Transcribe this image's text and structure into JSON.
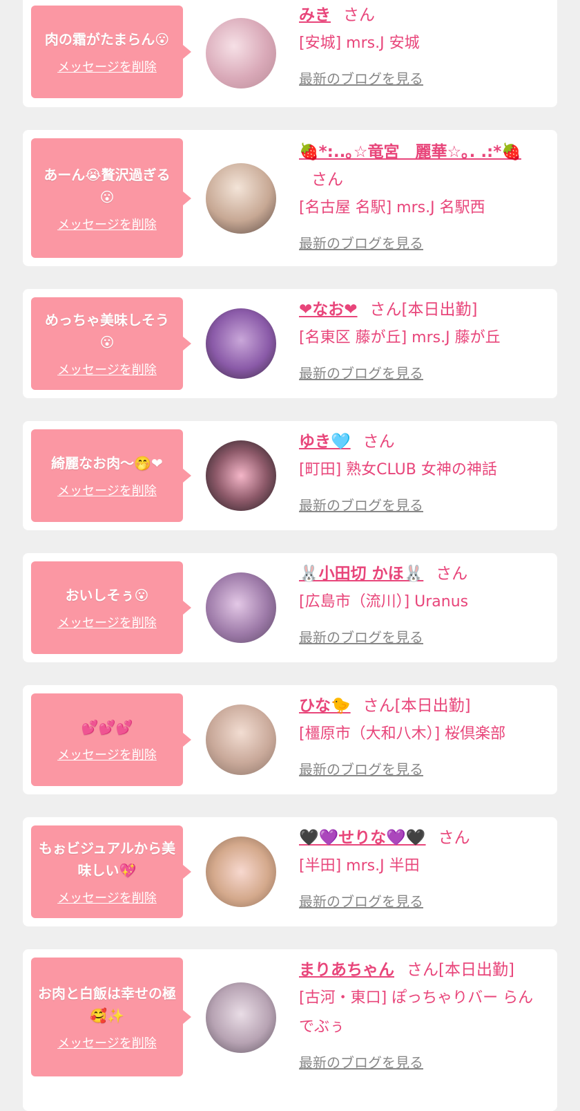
{
  "delete_label": "メッセージを削除",
  "blog_label": "最新のブログを見る",
  "cards": [
    {
      "message": "肉の霜がたまらん😮",
      "name": "みき",
      "suffix": "さん",
      "shop": "[安城] mrs.J 安城"
    },
    {
      "message": "あーん😭贅沢過ぎる😮",
      "name": "🍓*:..｡☆竜宮　麗華☆｡. .:*🍓",
      "suffix": "さん",
      "shop": "[名古屋 名駅] mrs.J 名駅西"
    },
    {
      "message": "めっちゃ美味しそう😮",
      "name": "❤なお❤",
      "suffix": "さん[本日出勤]",
      "shop": "[名東区 藤が丘] mrs.J 藤が丘"
    },
    {
      "message": "綺麗なお肉〜🤭❤",
      "name": "ゆき🩵",
      "suffix": "さん",
      "shop": "[町田] 熟女CLUB 女神の神話"
    },
    {
      "message": "おいしそぅ😮",
      "name": "🐰小田切 かほ🐰",
      "suffix": "さん",
      "shop": "[広島市（流川）] Uranus"
    },
    {
      "message": "💕💕💕",
      "name": "ひな🐤",
      "suffix": "さん[本日出勤]",
      "shop": "[橿原市（大和八木）] 桜倶楽部"
    },
    {
      "message": "もぉビジュアルから美味しい💖",
      "name": "🖤💜せりな💜🖤",
      "suffix": "さん",
      "shop": "[半田] mrs.J 半田"
    },
    {
      "message": "お肉と白飯は幸せの極🥰✨",
      "name": "まりあちゃん",
      "suffix": "さん[本日出勤]",
      "shop": "[古河・東口] ぽっちゃりバー らんでぶぅ"
    }
  ]
}
